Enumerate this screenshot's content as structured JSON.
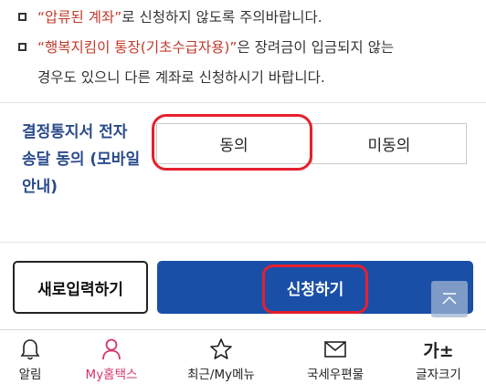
{
  "notice": {
    "row1": {
      "highlight": "“압류된 계좌”",
      "rest": "로 신청하지 않도록 주의바랍니다."
    },
    "row2": {
      "highlight": "“행복지킴이 통장(기초수급자용)”",
      "rest": "은 장려금이 입금되지 않는"
    },
    "row3": {
      "text": "경우도 있으니 다른 계좌로 신청하시기 바랍니다."
    }
  },
  "consent": {
    "label": "결정통지서 전자송달 동의 (모바일 안내)",
    "agree_label": "동의",
    "disagree_label": "미동의"
  },
  "actions": {
    "reset_label": "새로입력하기",
    "apply_label": "신청하기"
  },
  "tabbar": {
    "items": [
      {
        "label": "알림",
        "icon": "bell-icon"
      },
      {
        "label": "My홈택스",
        "icon": "person-icon"
      },
      {
        "label": "최근/My메뉴",
        "icon": "star-icon"
      },
      {
        "label": "국세우편물",
        "icon": "envelope-icon"
      },
      {
        "label": "글자크기",
        "icon": "text-size-icon",
        "glyph": "가±"
      }
    ]
  },
  "colors": {
    "accent_blue": "#1a4fa8",
    "highlight_red": "#c0392b",
    "annotation_red": "#e5202e",
    "active_tab": "#d6336c",
    "label_blue": "#2a4a8c"
  }
}
